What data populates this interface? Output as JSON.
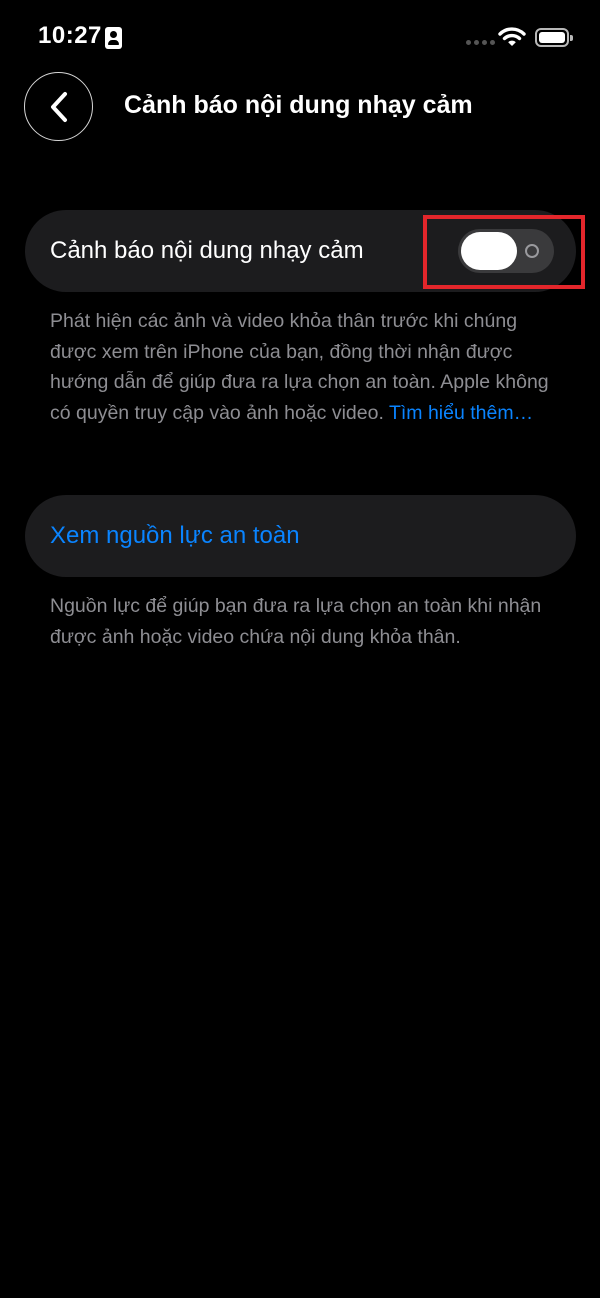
{
  "status_bar": {
    "time": "10:27",
    "icons": [
      "id-card-icon",
      "cellular-signal-icon",
      "wifi-icon",
      "battery-icon"
    ]
  },
  "nav": {
    "back_icon": "chevron-left-icon",
    "title": "Cảnh báo nội dung nhạy cảm"
  },
  "sensitive_warning": {
    "label": "Cảnh báo nội dung nhạy cảm",
    "toggle_state": "off",
    "description": "Phát hiện các ảnh và video khỏa thân trước khi chúng được xem trên iPhone của bạn, đồng thời nhận được hướng dẫn để giúp đưa ra lựa chọn an toàn. Apple không có quyền truy cập vào ảnh hoặc video.",
    "learn_more": "Tìm hiểu thêm…"
  },
  "safety_resources": {
    "label": "Xem nguồn lực an toàn",
    "description": "Nguồn lực để giúp bạn đưa ra lựa chọn an toàn khi nhận được ảnh hoặc video chứa nội dung khỏa thân."
  },
  "colors": {
    "background": "#000000",
    "card": "#1c1c1e",
    "accent": "#0a84ff",
    "secondary_text": "#8e8e93",
    "highlight": "#e3262b"
  }
}
